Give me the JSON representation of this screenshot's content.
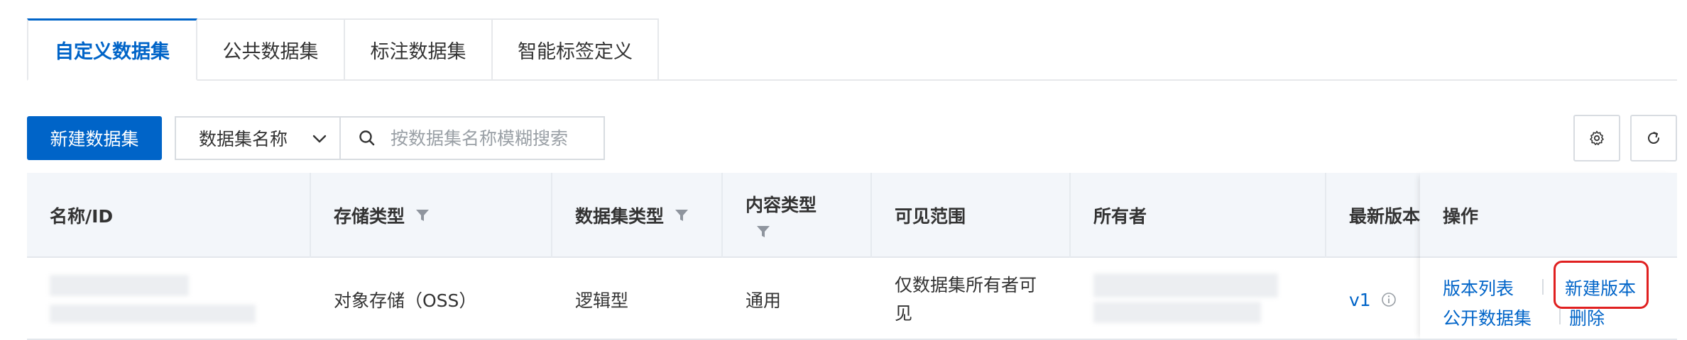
{
  "tabs": [
    {
      "label": "自定义数据集",
      "active": true
    },
    {
      "label": "公共数据集",
      "active": false
    },
    {
      "label": "标注数据集",
      "active": false
    },
    {
      "label": "智能标签定义",
      "active": false
    }
  ],
  "toolbar": {
    "new_button": "新建数据集",
    "search_field_select": "数据集名称",
    "search_placeholder": "按数据集名称模糊搜索",
    "icons": [
      "gear-icon",
      "refresh-icon"
    ]
  },
  "table": {
    "columns": [
      {
        "label": "名称/ID",
        "filter": false
      },
      {
        "label": "存储类型",
        "filter": true
      },
      {
        "label": "数据集类型",
        "filter": true
      },
      {
        "label": "内容类型",
        "filter": true
      },
      {
        "label": "可见范围",
        "filter": false
      },
      {
        "label": "所有者",
        "filter": false
      },
      {
        "label": "最新版本",
        "filter": false
      },
      {
        "label": "操作",
        "filter": false
      }
    ],
    "rows": [
      {
        "storage_type": "对象存储（OSS）",
        "dataset_type": "逻辑型",
        "content_type": "通用",
        "visibility_line1": "仅数据集所有者可",
        "visibility_line2": "见",
        "version": "v1",
        "actions": {
          "version_list": "版本列表",
          "new_version": "新建版本",
          "publish": "公开数据集",
          "delete": "删除"
        }
      }
    ]
  },
  "colors": {
    "primary": "#0064c8",
    "highlight_border": "#e02020",
    "header_bg": "#f3f6fa"
  }
}
